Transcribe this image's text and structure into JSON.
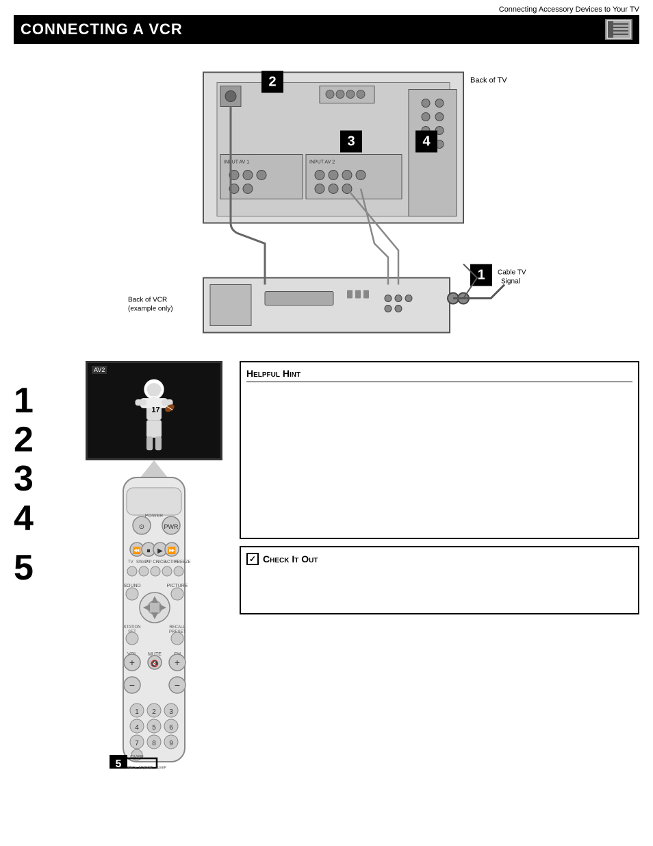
{
  "header": {
    "subtitle": "Connecting Accessory Devices to Your TV",
    "title_prefix": "Connecting a ",
    "title_main": "VCR"
  },
  "diagram": {
    "back_of_tv_label": "Back of TV",
    "cable_tv_label": "Cable TV\nSignal",
    "back_of_vcr_label": "Back of VCR\n(example only)",
    "step_numbers": [
      "1",
      "2",
      "3",
      "4"
    ]
  },
  "steps": {
    "numbers": [
      "1",
      "2",
      "3",
      "4",
      "5"
    ]
  },
  "tv_screen": {
    "label": "AV2"
  },
  "helpful_hint": {
    "title": "Helpful Hint",
    "content": ""
  },
  "check_it_out": {
    "title": "Check It Out",
    "content": ""
  },
  "step5_badge": "5"
}
